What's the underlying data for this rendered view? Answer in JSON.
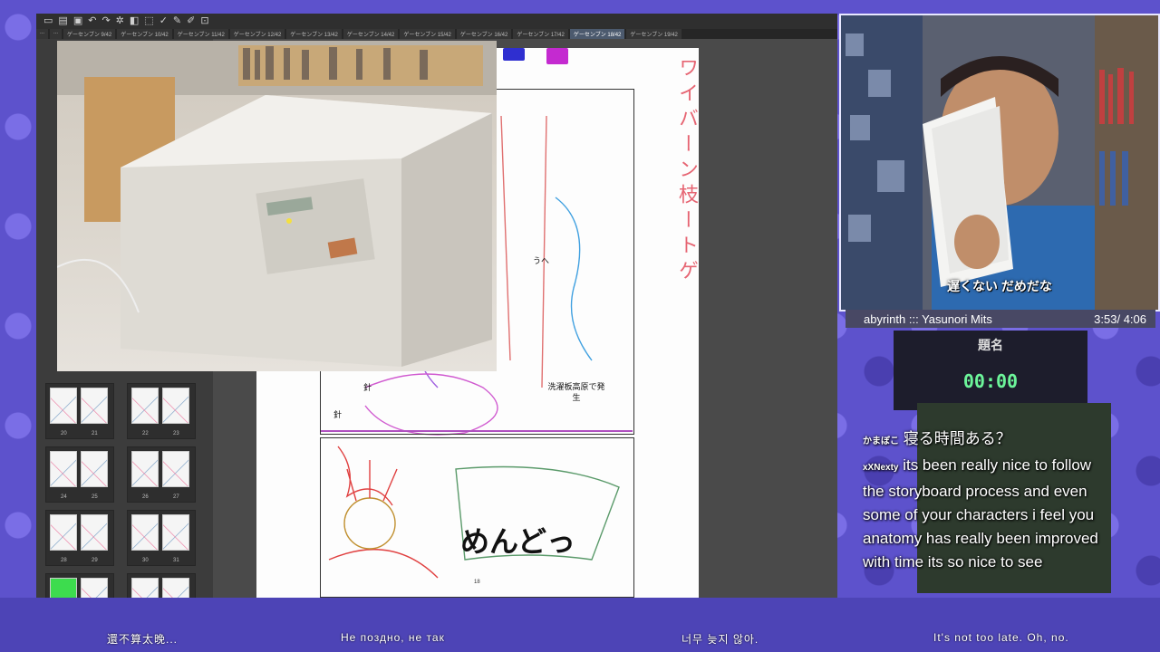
{
  "app": {
    "tabs": [
      "...",
      "...",
      "ゲーセンブン 9/42",
      "ゲーセンブン 10/42",
      "ゲーセンブン 11/42",
      "ゲーセンブン 12/42",
      "ゲーセンブン 13/42",
      "ゲーセンブン 14/42",
      "ゲーセンブン 15/42",
      "ゲーセンブン 16/42",
      "ゲーセンブン 17/42",
      "ゲーセンブン 18/42",
      "ゲーセンブン 19/42"
    ],
    "active_tab_index": 11,
    "toolbar_icons": [
      "new-icon",
      "open-icon",
      "save-icon",
      "undo-icon",
      "redo-icon",
      "settings-icon",
      "select-icon",
      "transform-icon",
      "check-icon",
      "edit-icon",
      "pen-icon",
      "ruler-icon"
    ]
  },
  "thumbnails": [
    {
      "left": "20",
      "right": "21"
    },
    {
      "left": "22",
      "right": "23"
    },
    {
      "left": "24",
      "right": "25"
    },
    {
      "left": "26",
      "right": "27"
    },
    {
      "left": "28",
      "right": "29"
    },
    {
      "left": "30",
      "right": "31"
    },
    {
      "left": "",
      "right": ""
    },
    {
      "left": "",
      "right": ""
    }
  ],
  "manga": {
    "speech_main": "めんどっ",
    "bubble_1": "洗濯板高原で発生",
    "bubble_2": "うへ",
    "label_needle_1": "針",
    "label_needle_2": "針",
    "page_number": "18",
    "vertical_note": "ワイバーン枝ートゲ"
  },
  "webcam": {
    "subtitle": "遅くない だめだな"
  },
  "music": {
    "title": "abyrinth  :::  Yasunori Mits",
    "time": "3:53/ 4:06"
  },
  "timer": {
    "title": "題名",
    "value": "00:00"
  },
  "chat": [
    {
      "user": "かまぼこ",
      "message": "寝る時間ある？"
    },
    {
      "user": "xXNexty",
      "message": "its been really nice to follow the storyboard process and even some of your characters i feel you anatomy has really been improved with time its so nice to see"
    }
  ],
  "subtitles": {
    "chinese": "還不算太晚...",
    "russian": "Не поздно, не так",
    "korean": "너무 늦지 않아.",
    "english": "It's not too late. Oh, no."
  }
}
